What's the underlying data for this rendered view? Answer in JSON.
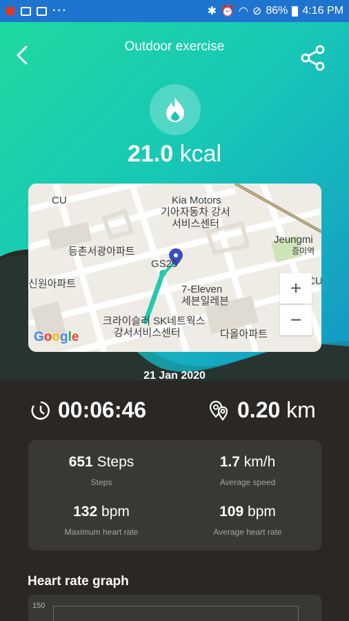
{
  "statusbar": {
    "battery": "86%",
    "time": "4:16 PM"
  },
  "header": {
    "title": "Outdoor exercise",
    "back_icon": "chevron-left-icon",
    "share_icon": "share-icon"
  },
  "calories": {
    "value": "21.0",
    "unit": "kcal",
    "icon": "flame-icon"
  },
  "map": {
    "labels": {
      "cu1": "CU",
      "kia_en": "Kia Motors",
      "kia_kr1": "기아자동차 강서",
      "kia_kr2": "서비스센터",
      "jeungmi_en": "Jeungmi",
      "jeungmi_kr": "증미역",
      "apt1": "등촌서광아파트",
      "gs": "GS25",
      "apt2": "신원아파트",
      "seven_en": "7-Eleven",
      "seven_kr": "세븐일레븐",
      "cu2": "CU",
      "sk1": "크라이슬러 SK네트웍스",
      "sk2": "강서서비스센터",
      "apt3": "다올아파트"
    },
    "zoom_in": "+",
    "zoom_out": "−",
    "attribution": "Google"
  },
  "date": "21 Jan 2020",
  "duration": {
    "value": "00:06:46",
    "icon": "timer-icon"
  },
  "distance": {
    "value": "0.20",
    "unit": "km",
    "icon": "location-pins-icon"
  },
  "stats": {
    "steps": {
      "value": "651",
      "unit": "Steps",
      "label": "Steps"
    },
    "speed": {
      "value": "1.7",
      "unit": "km/h",
      "label": "Average speed"
    },
    "max_hr": {
      "value": "132",
      "unit": "bpm",
      "label": "Maximum heart rate"
    },
    "avg_hr": {
      "value": "109",
      "unit": "bpm",
      "label": "Average heart rate"
    }
  },
  "graph": {
    "title": "Heart rate graph",
    "ytick_top": "150"
  },
  "colors": {
    "accent_green": "#1ed9a0",
    "accent_blue": "#1496c8",
    "dark_bg": "#2a2724",
    "card_bg": "#3a3835",
    "route": "#25c8b0"
  }
}
